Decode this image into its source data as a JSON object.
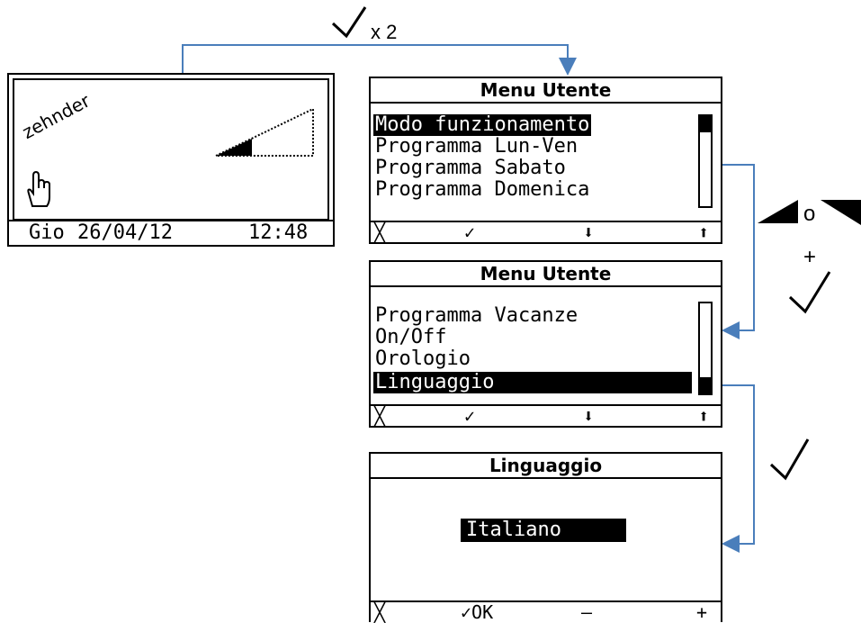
{
  "step1": {
    "check": "✓",
    "label": "x 2"
  },
  "step2": {
    "or_label": "o",
    "plus_label": "+",
    "check": "✓"
  },
  "step3": {
    "check": "✓"
  },
  "home_screen": {
    "brand": "zehnder",
    "status": {
      "day": "Gio",
      "date": "26/04/12",
      "time": "12:48"
    }
  },
  "menu1": {
    "title": "Menu Utente",
    "items": [
      "Modo funzionamento",
      "Programma Lun-Ven",
      "Programma Sabato",
      "Programma Domenica"
    ],
    "selected_index": 0,
    "scroll_position": 0.15
  },
  "menu2": {
    "title": "Menu Utente",
    "items": [
      "Programma Vacanze",
      "On/Off",
      "Orologio",
      "Linguaggio"
    ],
    "selected_index": 3,
    "scroll_position": 0.95
  },
  "language_screen": {
    "title": "Linguaggio",
    "value": "Italiano"
  },
  "softkeys_menu": [
    "╳",
    "✓",
    "⬇",
    "⬆"
  ],
  "softkeys_language": [
    "╳",
    "✓OK",
    "—",
    "+"
  ],
  "colors": {
    "connector": "#4a7ebb",
    "screen_border": "#000000"
  },
  "icons": [
    "hand-pointer-icon",
    "fan-level-icon",
    "arrow-up-triangle-icon",
    "arrow-down-triangle-icon"
  ]
}
